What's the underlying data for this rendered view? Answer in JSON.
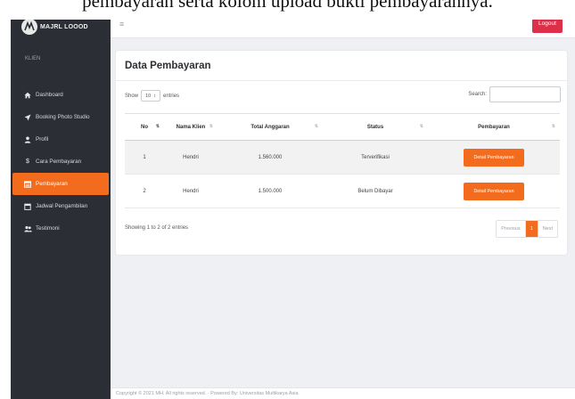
{
  "caption": "pembayaran serta kolom upload bukti pembayarannya.",
  "brand": {
    "name": "MAJRL LOOOD"
  },
  "sidebar": {
    "section": "KLIEN",
    "items": [
      {
        "label": "Dashboard",
        "icon": "home-icon"
      },
      {
        "label": "Booking Photo Studio",
        "icon": "send-icon"
      },
      {
        "label": "Profil",
        "icon": "user-icon"
      },
      {
        "label": "Cara Pembayaran",
        "icon": "dollar-icon"
      },
      {
        "label": "Pembayaran",
        "icon": "list-icon",
        "active": true
      },
      {
        "label": "Jadwal Pengambilan",
        "icon": "calendar-icon"
      },
      {
        "label": "Testimoni",
        "icon": "users-icon"
      }
    ]
  },
  "topbar": {
    "menu_icon": "hamburger-icon",
    "logout_label": "Logout"
  },
  "card": {
    "title": "Data Pembayaran",
    "show_label": "Show",
    "entries_value": "10",
    "entries_label": "entries",
    "search_label": "Search:",
    "columns": [
      "No",
      "Nama Klien",
      "Total Anggaran",
      "Status",
      "Pembayaran"
    ],
    "rows": [
      {
        "no": "1",
        "nama": "Hendri",
        "total": "1.560.000",
        "status": "Terverifikasi",
        "action": "Detail Pembayaran"
      },
      {
        "no": "2",
        "nama": "Hendri",
        "total": "1.500.000",
        "status": "Belum Dibayar",
        "action": "Detail Pembayaran"
      }
    ],
    "info": "Showing 1 to 2 of 2 entries",
    "pagination": {
      "previous": "Previous",
      "current": "1",
      "next": "Next"
    }
  },
  "footer": {
    "text": "Copyright © 2021 MH. All rights reserved. · Powered By: Universitas Multikarya Asia"
  },
  "colors": {
    "sidebar": "#2b2e34",
    "accent": "#f36b1c",
    "logout": "#dc2f4a",
    "background": "#eef0f3"
  }
}
